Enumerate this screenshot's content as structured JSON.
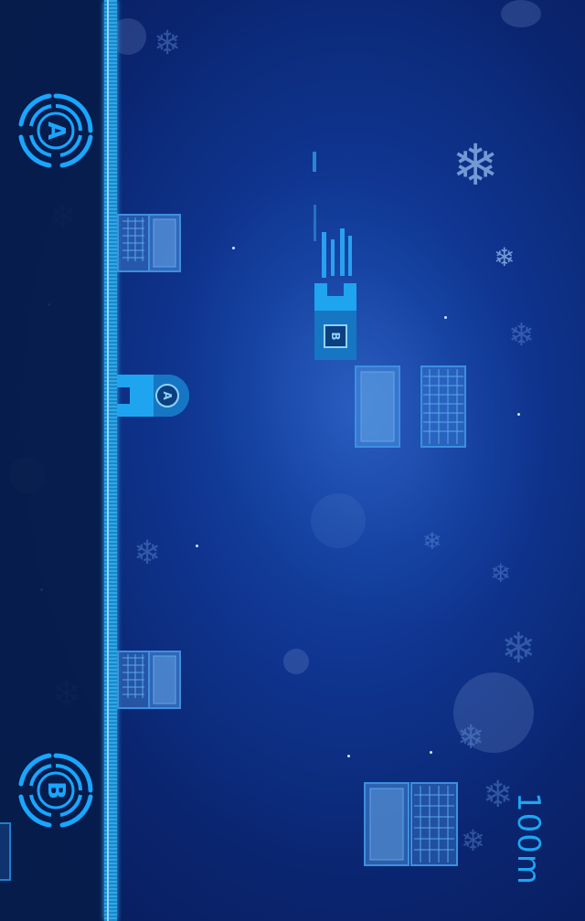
{
  "game": {
    "left_button_label": "A",
    "right_button_label": "B",
    "player_a_label": "A",
    "player_b_label": "B",
    "distance": "100m"
  },
  "colors": {
    "accent": "#19a6ff",
    "ground": "#2fa8e8",
    "panel": "#071c4a",
    "sky": "#0f3590"
  },
  "icons": [
    "button-a-icon",
    "button-b-icon",
    "laptop-icon",
    "tablet-icon",
    "keyboard-icon",
    "snowflake-icon"
  ]
}
